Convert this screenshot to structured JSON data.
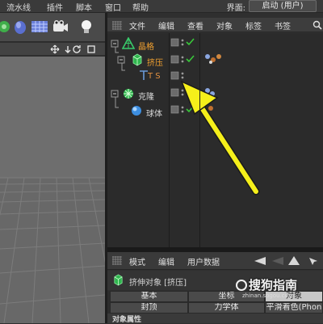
{
  "menubar": {
    "items": [
      "流水线",
      "插件",
      "脚本",
      "窗口",
      "帮助"
    ],
    "layout_label": "界面:",
    "layout_value": "启动 (用户)"
  },
  "object_manager": {
    "menu": [
      "文件",
      "编辑",
      "查看",
      "对象",
      "标签",
      "书签"
    ],
    "objects": [
      {
        "name": "晶格",
        "icon": "lattice-icon",
        "color": "#f0a030"
      },
      {
        "name": "挤压",
        "icon": "extrude-icon",
        "color": "#f0a030"
      },
      {
        "name": "T S",
        "icon": "text-spline-icon",
        "color": "#e09040"
      },
      {
        "name": "克隆",
        "icon": "cloner-icon",
        "color": "#d8d8d8"
      },
      {
        "name": "球体",
        "icon": "sphere-icon",
        "color": "#d8d8d8"
      }
    ]
  },
  "attribute_manager": {
    "menu": [
      "模式",
      "编辑",
      "用户数据"
    ],
    "title": "挤伸对象 [挤压]",
    "tabs_row1": [
      "基本",
      "坐标",
      "对象"
    ],
    "tabs_row2": [
      "封顶",
      "力学体",
      "平滑着色(Phon"
    ],
    "active_tab": "对象",
    "bottom_text": "对象属性"
  },
  "watermark": {
    "text": "搜狗指南",
    "sub": "zhinan.sogou.com"
  },
  "colors": {
    "arrow": "#f5ef1a",
    "check": "#39c93a",
    "accent_orange": "#f0a030"
  }
}
